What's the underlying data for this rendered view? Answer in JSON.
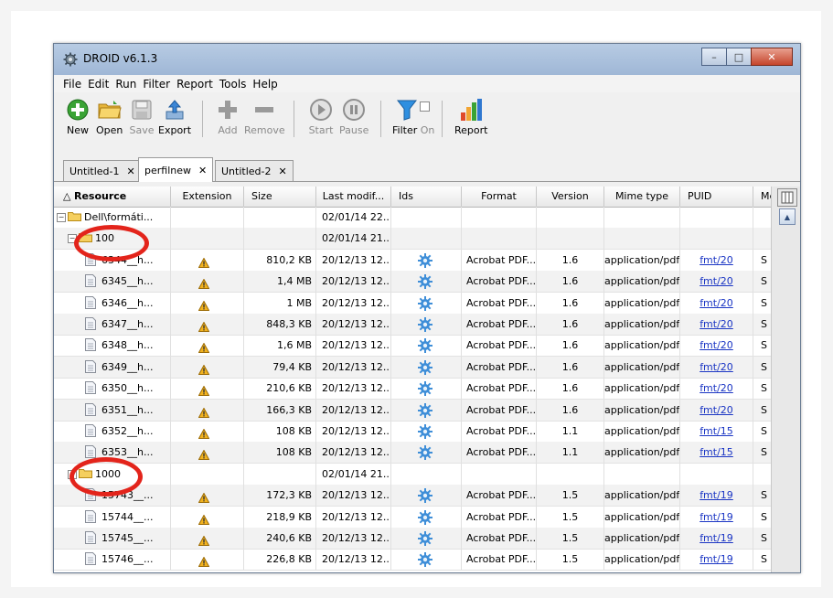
{
  "window": {
    "title": "DROID v6.1.3"
  },
  "menu": [
    "File",
    "Edit",
    "Run",
    "Filter",
    "Report",
    "Tools",
    "Help"
  ],
  "toolbar": {
    "new": "New",
    "open": "Open",
    "save": "Save",
    "export": "Export",
    "add": "Add",
    "remove": "Remove",
    "start": "Start",
    "pause": "Pause",
    "filter": "Filter",
    "filter_state": "On",
    "report": "Report"
  },
  "tabs": [
    {
      "label": "Untitled-1"
    },
    {
      "label": "perfilnew"
    },
    {
      "label": "Untitled-2"
    }
  ],
  "columns": [
    "Resource",
    "Extension",
    "Size",
    "Last modif...",
    "Ids",
    "Format",
    "Version",
    "Mime type",
    "PUID",
    "Me"
  ],
  "rows": [
    {
      "resource": "Dell\\formáti...",
      "last": "02/01/14 22..."
    },
    {
      "resource": "100",
      "last": "02/01/14 21..."
    },
    {
      "resource": "6344__h...",
      "size": "810,2 KB",
      "last": "20/12/13 12...",
      "format": "Acrobat PDF...",
      "version": "1.6",
      "mime": "application/pdf",
      "puid": "fmt/20",
      "me": "S"
    },
    {
      "resource": "6345__h...",
      "size": "1,4 MB",
      "last": "20/12/13 12...",
      "format": "Acrobat PDF...",
      "version": "1.6",
      "mime": "application/pdf",
      "puid": "fmt/20",
      "me": "S"
    },
    {
      "resource": "6346__h...",
      "size": "1 MB",
      "last": "20/12/13 12...",
      "format": "Acrobat PDF...",
      "version": "1.6",
      "mime": "application/pdf",
      "puid": "fmt/20",
      "me": "S"
    },
    {
      "resource": "6347__h...",
      "size": "848,3 KB",
      "last": "20/12/13 12...",
      "format": "Acrobat PDF...",
      "version": "1.6",
      "mime": "application/pdf",
      "puid": "fmt/20",
      "me": "S"
    },
    {
      "resource": "6348__h...",
      "size": "1,6 MB",
      "last": "20/12/13 12...",
      "format": "Acrobat PDF...",
      "version": "1.6",
      "mime": "application/pdf",
      "puid": "fmt/20",
      "me": "S"
    },
    {
      "resource": "6349__h...",
      "size": "79,4 KB",
      "last": "20/12/13 12...",
      "format": "Acrobat PDF...",
      "version": "1.6",
      "mime": "application/pdf",
      "puid": "fmt/20",
      "me": "S"
    },
    {
      "resource": "6350__h...",
      "size": "210,6 KB",
      "last": "20/12/13 12...",
      "format": "Acrobat PDF...",
      "version": "1.6",
      "mime": "application/pdf",
      "puid": "fmt/20",
      "me": "S"
    },
    {
      "resource": "6351__h...",
      "size": "166,3 KB",
      "last": "20/12/13 12...",
      "format": "Acrobat PDF...",
      "version": "1.6",
      "mime": "application/pdf",
      "puid": "fmt/20",
      "me": "S"
    },
    {
      "resource": "6352__h...",
      "size": "108 KB",
      "last": "20/12/13 12...",
      "format": "Acrobat PDF...",
      "version": "1.1",
      "mime": "application/pdf",
      "puid": "fmt/15",
      "me": "S"
    },
    {
      "resource": "6353__h...",
      "size": "108 KB",
      "last": "20/12/13 12...",
      "format": "Acrobat PDF...",
      "version": "1.1",
      "mime": "application/pdf",
      "puid": "fmt/15",
      "me": "S"
    },
    {
      "resource": "1000",
      "last": "02/01/14 21..."
    },
    {
      "resource": "15743__...",
      "size": "172,3 KB",
      "last": "20/12/13 12...",
      "format": "Acrobat PDF...",
      "version": "1.5",
      "mime": "application/pdf",
      "puid": "fmt/19",
      "me": "S"
    },
    {
      "resource": "15744__...",
      "size": "218,9 KB",
      "last": "20/12/13 12...",
      "format": "Acrobat PDF...",
      "version": "1.5",
      "mime": "application/pdf",
      "puid": "fmt/19",
      "me": "S"
    },
    {
      "resource": "15745__...",
      "size": "240,6 KB",
      "last": "20/12/13 12...",
      "format": "Acrobat PDF...",
      "version": "1.5",
      "mime": "application/pdf",
      "puid": "fmt/19",
      "me": "S"
    },
    {
      "resource": "15746__...",
      "size": "226,8 KB",
      "last": "20/12/13 12...",
      "format": "Acrobat PDF...",
      "version": "1.5",
      "mime": "application/pdf",
      "puid": "fmt/19",
      "me": "S"
    }
  ],
  "colors": {
    "annotation": "#e3241b",
    "link": "#1a35c4",
    "titlebar": "#b7cbe3"
  }
}
